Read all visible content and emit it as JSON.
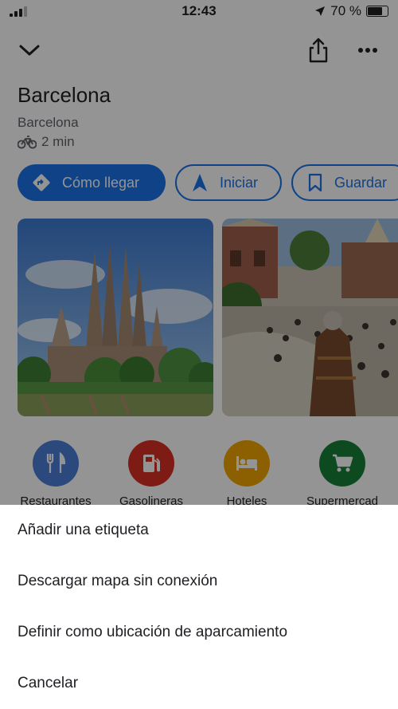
{
  "status_bar": {
    "time": "12:43",
    "battery": "70 %",
    "battery_level": 0.7
  },
  "place": {
    "name": "Barcelona",
    "subtitle": "Barcelona",
    "eta": "2 min",
    "eta_mode_icon": "bicycle-icon"
  },
  "actions": {
    "directions": "Cómo llegar",
    "start": "Iniciar",
    "save": "Guardar"
  },
  "nearby": [
    {
      "label": "Restaurantes",
      "icon": "restaurant-icon",
      "color": "#4a7fd8"
    },
    {
      "label": "Gasolineras",
      "icon": "gas-station-icon",
      "color": "#d93025"
    },
    {
      "label": "Hoteles",
      "icon": "hotel-icon",
      "color": "#f2a600"
    },
    {
      "label": "Supermercad",
      "icon": "shopping-cart-icon",
      "color": "#188038"
    }
  ],
  "sheet": {
    "items": [
      "Añadir una etiqueta",
      "Descargar mapa sin conexión",
      "Definir como ubicación de aparcamiento",
      "Cancelar"
    ]
  },
  "colors": {
    "accent": "#1a73e8",
    "overlay": "rgba(0,0,0,0.42)"
  }
}
